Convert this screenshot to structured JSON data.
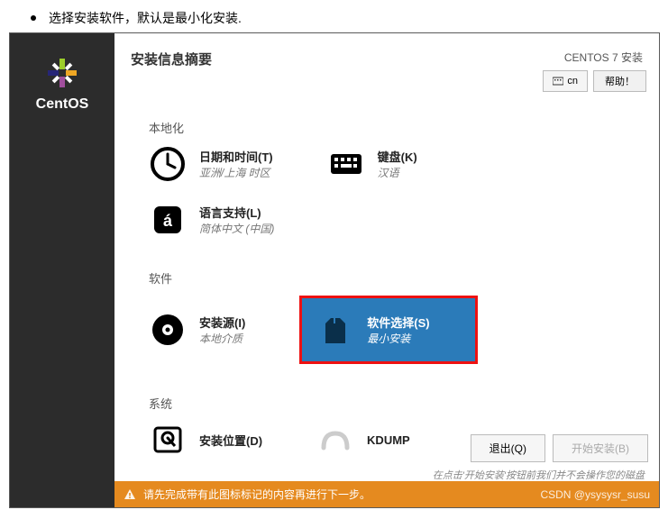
{
  "caption": "选择安装软件，默认是最小化安装.",
  "brand": "CentOS",
  "header": {
    "title": "安装信息摘要",
    "install_label": "CENTOS 7 安装",
    "lang_indicator": "cn",
    "help_btn": "帮助！"
  },
  "sections": {
    "localization": {
      "label": "本地化",
      "datetime": {
        "title": "日期和时间(T)",
        "sub": "亚洲/上海 时区"
      },
      "keyboard": {
        "title": "键盘(K)",
        "sub": "汉语"
      },
      "language": {
        "title": "语言支持(L)",
        "sub": "简体中文 (中国)"
      }
    },
    "software": {
      "label": "软件",
      "source": {
        "title": "安装源(I)",
        "sub": "本地介质"
      },
      "selection": {
        "title": "软件选择(S)",
        "sub": "最小安装"
      }
    },
    "system": {
      "label": "系统",
      "destination": {
        "title": "安装位置(D)",
        "sub": ""
      },
      "kdump": {
        "title": "KDUMP",
        "sub": ""
      }
    }
  },
  "buttons": {
    "quit": "退出(Q)",
    "begin": "开始安装(B)"
  },
  "hint": "在点击'开始安装'按钮前我们并不会操作您的磁盘",
  "warning": "请先完成带有此图标标记的内容再进行下一步。",
  "watermark": "CSDN @ysysysr_susu"
}
